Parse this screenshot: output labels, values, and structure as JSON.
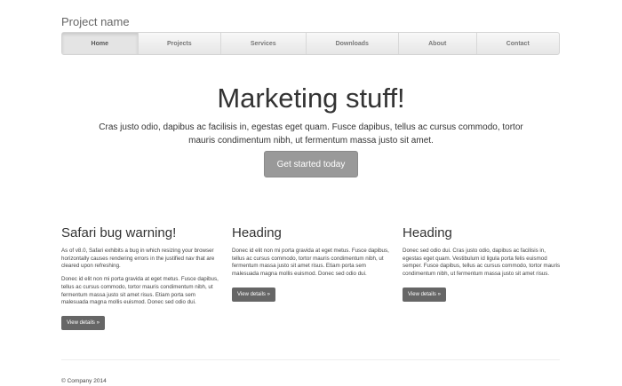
{
  "header": {
    "brand": "Project name",
    "nav": [
      "Home",
      "Projects",
      "Services",
      "Downloads",
      "About",
      "Contact"
    ],
    "active_nav": "Home"
  },
  "jumbotron": {
    "title": "Marketing stuff!",
    "lead": "Cras justo odio, dapibus ac facilisis in, egestas eget quam. Fusce dapibus, tellus ac cursus commodo, tortor mauris condimentum nibh, ut fermentum massa justo sit amet.",
    "cta_label": "Get started today"
  },
  "columns": [
    {
      "heading": "Safari bug warning!",
      "paragraphs": [
        "As of v8.0, Safari exhibits a bug in which resizing your browser horizontally causes rendering errors in the justified nav that are cleared upon refreshing.",
        "Donec id elit non mi porta gravida at eget metus. Fusce dapibus, tellus ac cursus commodo, tortor mauris condimentum nibh, ut fermentum massa justo sit amet risus. Etiam porta sem malesuada magna mollis euismod. Donec sed odio dui."
      ],
      "button": "View details »"
    },
    {
      "heading": "Heading",
      "paragraphs": [
        "Donec id elit non mi porta gravida at eget metus. Fusce dapibus, tellus ac cursus commodo, tortor mauris condimentum nibh, ut fermentum massa justo sit amet risus. Etiam porta sem malesuada magna mollis euismod. Donec sed odio dui."
      ],
      "button": "View details »"
    },
    {
      "heading": "Heading",
      "paragraphs": [
        "Donec sed odio dui. Cras justo odio, dapibus ac facilisis in, egestas eget quam. Vestibulum id ligula porta felis euismod semper. Fusce dapibus, tellus ac cursus commodo, tortor mauris condimentum nibh, ut fermentum massa justo sit amet risus."
      ],
      "button": "View details »"
    }
  ],
  "footer": {
    "copyright": "© Company 2014"
  },
  "colors": {
    "cta": "#999999",
    "details_button": "#666666",
    "nav_border": "#d4d4d4"
  }
}
